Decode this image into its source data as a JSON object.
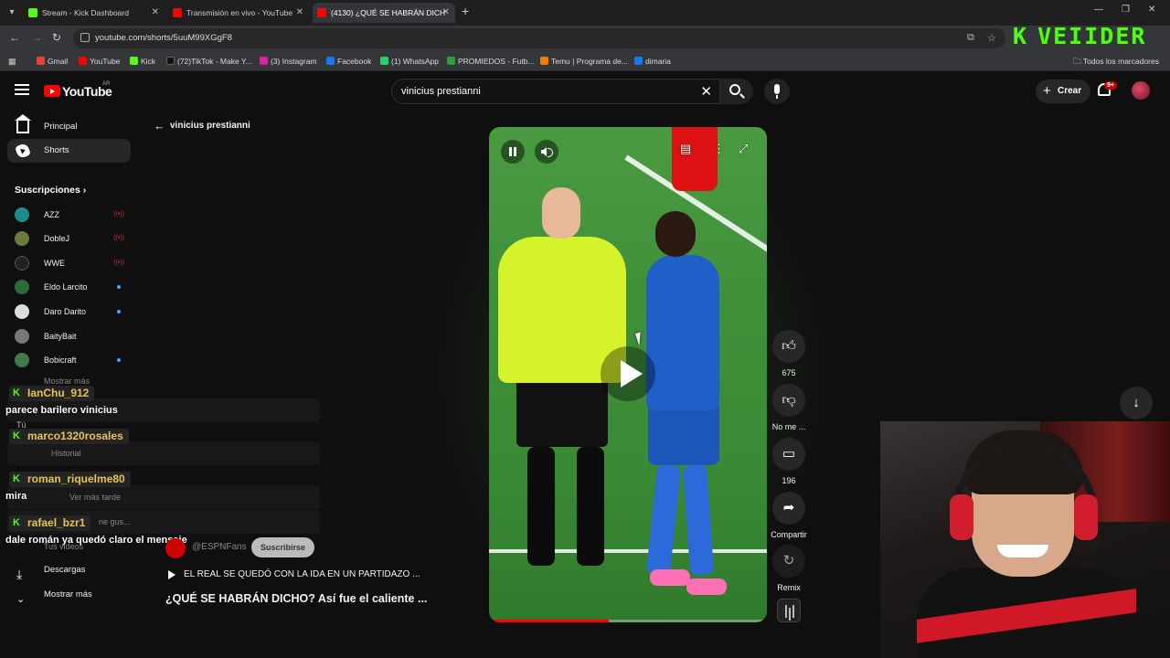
{
  "browser": {
    "tabs": [
      {
        "label": "Stream - Kick Dashboard",
        "favicon_color": "#53fc18",
        "active": false
      },
      {
        "label": "Transmisión en vivo - YouTube",
        "favicon_color": "#ff0000",
        "active": false
      },
      {
        "label": "(4130) ¿QUÉ SE HABRÁN DICH",
        "favicon_color": "#ff0000",
        "active": true
      }
    ],
    "url": "youtube.com/shorts/5uuM99XGgF8",
    "bookmarks": [
      {
        "label": "Gmail",
        "color": "#ea4335"
      },
      {
        "label": "YouTube",
        "color": "#ff0000"
      },
      {
        "label": "Kick",
        "color": "#53fc18"
      },
      {
        "label": "(72)TikTok - Make Y...",
        "color": "#111111"
      },
      {
        "label": "(3) Instagram",
        "color": "#d6249f"
      },
      {
        "label": "Facebook",
        "color": "#1877f2"
      },
      {
        "label": "(1) WhatsApp",
        "color": "#25d366"
      },
      {
        "label": "PROMIEDOS - Futb...",
        "color": "#2e9d3a"
      },
      {
        "label": "Temu | Programa de...",
        "color": "#f57c00"
      },
      {
        "label": "dimaria",
        "color": "#1877f2"
      }
    ],
    "all_bookmarks": "Todos los marcadores"
  },
  "watermark": {
    "k": "K",
    "name": "VEIIDER",
    "color": "#53fc18"
  },
  "header": {
    "logo_word": "YouTube",
    "country": "AR",
    "search_value": "vinicius prestianni",
    "create_label": "Crear",
    "notif_badge": "9+"
  },
  "sidebar": {
    "items": [
      {
        "label": "Principal",
        "icon": "home-icon"
      },
      {
        "label": "Shorts",
        "icon": "shorts-icon"
      }
    ],
    "subs_title": "Suscripciones",
    "subscriptions": [
      {
        "label": "AZZ",
        "color": "#1a8f8a",
        "live": true
      },
      {
        "label": "DobleJ",
        "color": "#6d7b3a",
        "live": true
      },
      {
        "label": "WWE",
        "color": "#222222",
        "live": true
      },
      {
        "label": "Eldo Larcito",
        "color": "#2e6b3a",
        "live": false,
        "dot": true
      },
      {
        "label": "Daro Darito",
        "color": "#dddddd",
        "live": false,
        "dot": true
      },
      {
        "label": "BaityBait",
        "color": "#777777",
        "live": false,
        "dot": false
      },
      {
        "label": "Bobicraft",
        "color": "#3f7a4d",
        "live": false,
        "dot": true
      }
    ],
    "hidden_rows": [
      "Mostrar más",
      "Tú",
      "Historial",
      "Ver más tarde",
      "Tus videos",
      "...ne gus..."
    ],
    "ghost": {
      "historial": "Historial",
      "ver_mas_tarde": "Ver más tarde",
      "tus_videos": "Tus videos",
      "me_gusta": "ne gus...",
      "mostrar_mas_top": "Mostrar más",
      "tu": "Tú"
    },
    "bottom": [
      {
        "label": "Descargas"
      },
      {
        "label": "Mostrar más"
      }
    ]
  },
  "chat": [
    {
      "user": "IanChu_912",
      "message": "parece barilero vinicius"
    },
    {
      "user": "marco1320rosales",
      "message": ""
    },
    {
      "user": "roman_riquelme80",
      "message": "mira"
    },
    {
      "user": "rafael_bzr1",
      "message": "dale román ya quedó claro el mensaje"
    }
  ],
  "search_back": "vinicius prestianni",
  "short": {
    "channel": "@ESPNFans",
    "subscribe": "Suscribirse",
    "song": "EL REAL SE QUEDÓ CON LA IDA EN UN PARTIDAZO ...",
    "title": "¿QUÉ SE HABRÁN DICHO? Así fue el caliente ...",
    "progress": 0.43
  },
  "actions": {
    "like_count": "675",
    "dislike_label": "No me ...",
    "comments_count": "196",
    "share_label": "Compartir",
    "remix_label": "Remix"
  }
}
